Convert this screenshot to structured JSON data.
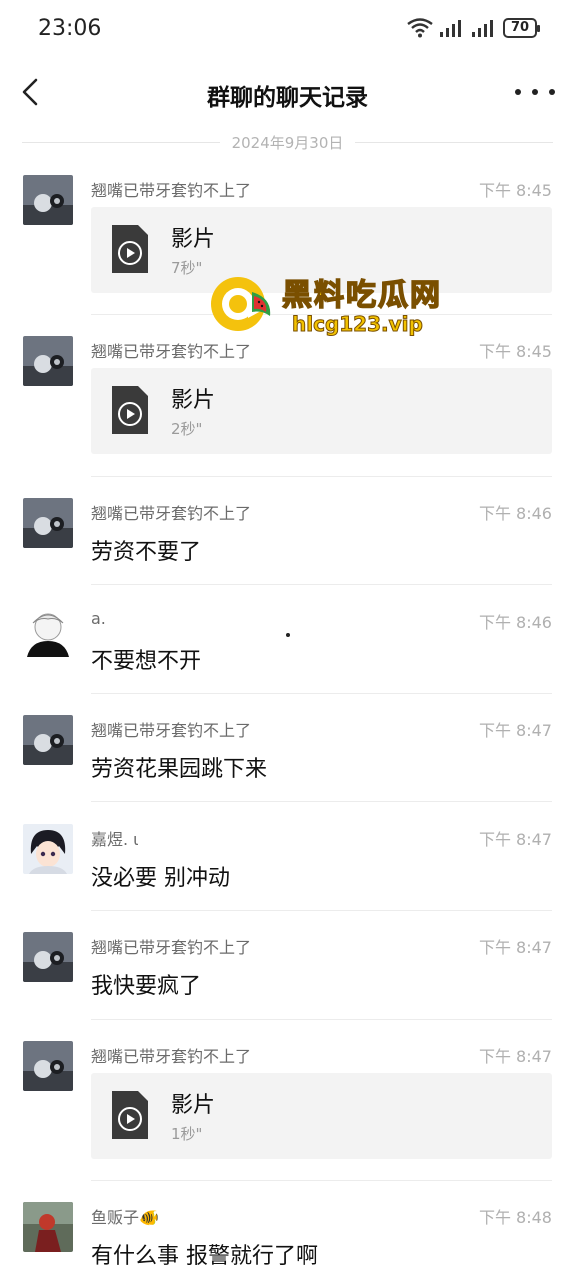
{
  "status_bar": {
    "time": "23:06",
    "battery": "70"
  },
  "header": {
    "title": "群聊的聊天记录"
  },
  "date_divider": "2024年9月30日",
  "messages": [
    {
      "sender": "翘嘴已带牙套钓不上了",
      "time": "下午 8:45",
      "video_title": "影片",
      "video_duration": "7秒\""
    },
    {
      "sender": "翘嘴已带牙套钓不上了",
      "time": "下午 8:45",
      "video_title": "影片",
      "video_duration": "2秒\""
    },
    {
      "sender": "翘嘴已带牙套钓不上了",
      "time": "下午 8:46",
      "text": "劳资不要了"
    },
    {
      "sender": "a.",
      "time": "下午 8:46",
      "text": "不要想不开"
    },
    {
      "sender": "翘嘴已带牙套钓不上了",
      "time": "下午 8:47",
      "text": "劳资花果园跳下来"
    },
    {
      "sender": "嘉煜. ι",
      "time": "下午 8:47",
      "text": "没必要 别冲动"
    },
    {
      "sender": "翘嘴已带牙套钓不上了",
      "time": "下午 8:47",
      "text": "我快要疯了"
    },
    {
      "sender": "翘嘴已带牙套钓不上了",
      "time": "下午 8:47",
      "video_title": "影片",
      "video_duration": "1秒\""
    },
    {
      "sender": "鱼贩子🐠",
      "time": "下午 8:48",
      "text": "有什么事 报警就行了啊"
    }
  ],
  "watermark": {
    "title": "黑料吃瓜网",
    "url": "hlcg123.vip"
  },
  "icons": {
    "back": "chevron-left-icon",
    "more": "more-dots-icon",
    "video_file": "video-file-icon",
    "wifi": "wifi-icon",
    "signal": "signal-icon",
    "battery": "battery-icon"
  }
}
